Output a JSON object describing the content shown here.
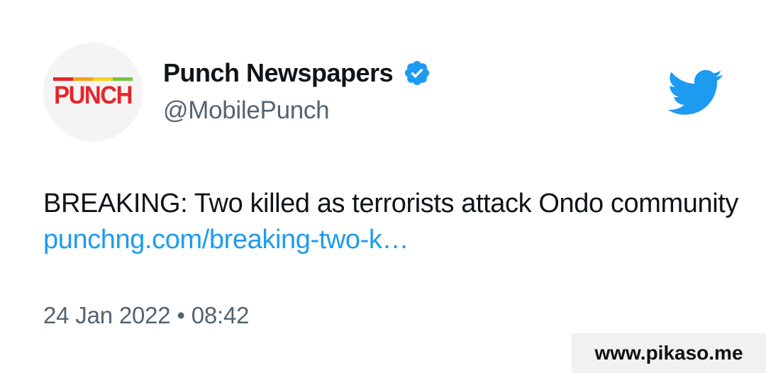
{
  "account": {
    "avatar_text": "PUNCH",
    "display_name": "Punch Newspapers",
    "handle": "@MobilePunch",
    "verified_icon": "verified-badge-icon",
    "avatar_stripe_colors": [
      "#e5262b",
      "#f7a21b",
      "#f4d21f",
      "#7cc242"
    ]
  },
  "brand_icon": "twitter-bird-icon",
  "tweet": {
    "text": "BREAKING: Two killed as terrorists attack Ondo community",
    "link_text": "punchng.com/breaking-two-k…",
    "timestamp": "24 Jan 2022 • 08:42"
  },
  "watermark": {
    "text": "www.pikaso.me"
  },
  "colors": {
    "accent": "#1d9bf0",
    "text_primary": "#0f1419",
    "text_secondary": "#536471",
    "logo_red": "#e5262b"
  }
}
